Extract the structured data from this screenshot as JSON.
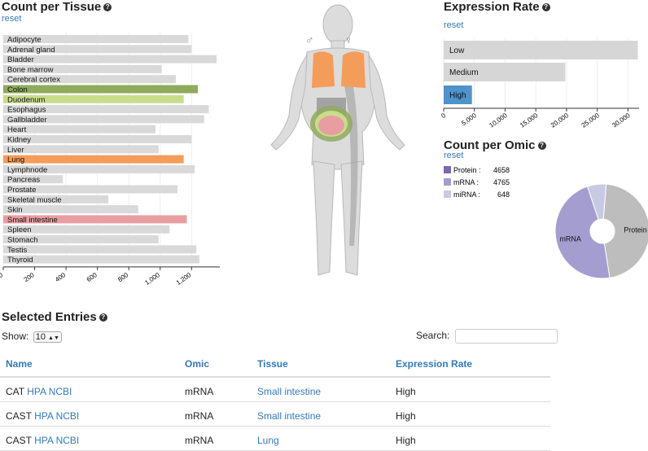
{
  "tissue_panel": {
    "title": "Count per Tissue",
    "reset": "reset"
  },
  "expression_panel": {
    "title": "Expression Rate",
    "reset": "reset"
  },
  "omic_panel": {
    "title": "Count per Omic",
    "reset": "reset"
  },
  "body_figure": {
    "male_symbol": "♂",
    "female_symbol": "♀"
  },
  "chart_data": [
    {
      "type": "bar",
      "orientation": "horizontal",
      "title": "Count per Tissue",
      "categories": [
        "Adipocyte",
        "Adrenal gland",
        "Bladder",
        "Bone marrow",
        "Cerebral cortex",
        "Colon",
        "Duodenum",
        "Esophagus",
        "Gallbladder",
        "Heart",
        "Kidney",
        "Liver",
        "Lung",
        "Lymphnode",
        "Pancreas",
        "Prostate",
        "Skeletal muscle",
        "Skin",
        "Small intestine",
        "Spleen",
        "Stomach",
        "Testis",
        "Thyroid"
      ],
      "values": [
        1180,
        1200,
        1360,
        1010,
        1100,
        1240,
        1150,
        1310,
        1280,
        970,
        1200,
        990,
        1150,
        1220,
        380,
        1110,
        670,
        860,
        1170,
        1060,
        990,
        1230,
        1250
      ],
      "highlight_colors": {
        "Colon": "#8faa5d",
        "Duodenum": "#c9dc8c",
        "Lung": "#f49c59",
        "Small intestine": "#e89ea0"
      },
      "xticks": [
        0,
        200,
        400,
        600,
        800,
        1000,
        1200
      ],
      "xtick_labels": [
        "0",
        "200",
        "400",
        "600",
        "800",
        "1,000",
        "1,200"
      ],
      "xlim": [
        0,
        1380
      ],
      "bar_color": "#d9d9d9"
    },
    {
      "type": "bar",
      "orientation": "horizontal",
      "title": "Expression Rate",
      "categories": [
        "Low",
        "Medium",
        "High"
      ],
      "values": [
        31600,
        19800,
        4600
      ],
      "selected": "High",
      "selected_color": "#4f93cb",
      "xticks": [
        0,
        5000,
        10000,
        15000,
        20000,
        25000,
        30000
      ],
      "xtick_labels": [
        "0",
        "5,000",
        "10,000",
        "15,000",
        "20,000",
        "25,000",
        "30,000"
      ],
      "xlim": [
        0,
        31800
      ]
    },
    {
      "type": "pie",
      "title": "Count per Omic",
      "labels": [
        "Protein",
        "mRNA",
        "miRNA"
      ],
      "values": [
        4658,
        4765,
        648
      ],
      "colors": [
        "#bdbdbd",
        "#a49ed0",
        "#c8cae4"
      ],
      "legend_colors": [
        "#7b68b0",
        "#a49ed0",
        "#c8cae4"
      ],
      "legend": [
        {
          "label": "Protein :",
          "value": "4658"
        },
        {
          "label": "mRNA :",
          "value": "4765"
        },
        {
          "label": "miRNA :",
          "value": "648"
        }
      ]
    }
  ],
  "entries": {
    "title": "Selected Entries",
    "show_label": "Show:",
    "page_size": "10",
    "search_label": "Search:",
    "search_value": "",
    "columns": [
      "Name",
      "Omic",
      "Tissue",
      "Expression Rate"
    ],
    "rows": [
      {
        "gene": "CAT",
        "links": "HPA NCBI",
        "omic": "mRNA",
        "tissue": "Small intestine",
        "rate": "High"
      },
      {
        "gene": "CAST",
        "links": "HPA NCBI",
        "omic": "mRNA",
        "tissue": "Small intestine",
        "rate": "High"
      },
      {
        "gene": "CAST",
        "links": "HPA NCBI",
        "omic": "mRNA",
        "tissue": "Lung",
        "rate": "High"
      }
    ]
  }
}
